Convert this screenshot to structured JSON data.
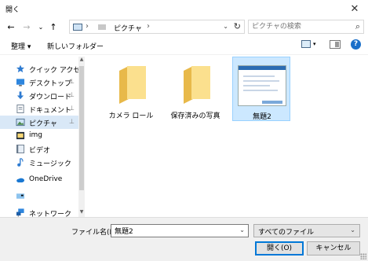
{
  "window": {
    "title": "開く",
    "close_glyph": "✕"
  },
  "address": {
    "back_glyph": "←",
    "forward_glyph": "→",
    "recent_glyph": "⌄",
    "up_glyph": "↑",
    "sep_glyph": "›",
    "crumb": "ピクチャ",
    "refresh_glyph": "↻",
    "dropdown_glyph": "⌄"
  },
  "search": {
    "placeholder": "ピクチャの検索",
    "icon_glyph": "⌕"
  },
  "toolbar": {
    "organize_label": "整理 ▾",
    "new_folder_label": "新しいフォルダー",
    "help_glyph": "?",
    "view_dropdown_glyph": "▾"
  },
  "sidebar": {
    "items": [
      {
        "label": "クイック アクセス",
        "icon": "star-icon",
        "pinned": false
      },
      {
        "label": "デスクトップ",
        "icon": "desktop-icon",
        "pinned": true
      },
      {
        "label": "ダウンロード",
        "icon": "download-icon",
        "pinned": true
      },
      {
        "label": "ドキュメント",
        "icon": "document-icon",
        "pinned": true
      },
      {
        "label": "ピクチャ",
        "icon": "pictures-icon",
        "pinned": true,
        "selected": true
      },
      {
        "label": "img",
        "icon": "folder-icon",
        "pinned": false
      },
      {
        "label": "ビデオ",
        "icon": "video-icon",
        "pinned": false
      },
      {
        "label": "ミュージック",
        "icon": "music-icon",
        "pinned": false
      },
      {
        "label": "OneDrive",
        "icon": "onedrive-icon",
        "pinned": false
      },
      {
        "label": "",
        "icon": "pc-icon",
        "pinned": false
      },
      {
        "label": "ネットワーク",
        "icon": "network-icon",
        "pinned": false
      }
    ],
    "pin_glyph": "⊥",
    "scroll_up_glyph": "▲",
    "scroll_down_glyph": "▼"
  },
  "files": [
    {
      "name": "カメラ ロール",
      "type": "folder"
    },
    {
      "name": "保存済みの写真",
      "type": "folder"
    },
    {
      "name": "無題2",
      "type": "image",
      "selected": true
    }
  ],
  "bottom": {
    "filename_label": "ファイル名(N):",
    "filename_value": "無題2",
    "filetype_value": "すべてのファイル",
    "open_label": "開く(O)",
    "cancel_label": "キャンセル",
    "dropdown_glyph": "⌄"
  },
  "colors": {
    "selection": "#cce8ff",
    "accent": "#0078d7",
    "folder": "#f8d775"
  }
}
